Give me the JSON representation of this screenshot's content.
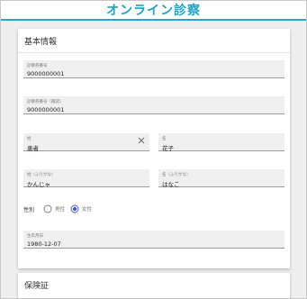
{
  "app": {
    "title": "オンライン診察"
  },
  "basic_info": {
    "title": "基本情報",
    "fields": [
      {
        "label": "診察券番号",
        "value": "9000000001"
      },
      {
        "label": "診察券番号（確認）",
        "value": "9000000001"
      },
      {
        "label": "姓",
        "value": "患者"
      },
      {
        "label": "名",
        "value": "花子"
      },
      {
        "label": "姓（ふりがな）",
        "value": "かんじゃ"
      },
      {
        "label": "名（ふりがな）",
        "value": "はなこ"
      },
      {
        "label": "生年月日",
        "value": "1980-12-07"
      }
    ],
    "gender": {
      "label": "性別",
      "options": [
        "男性",
        "女性"
      ],
      "selected": "女性"
    }
  },
  "insurance": {
    "title": "保険証"
  },
  "colors": {
    "accent": "#1aa3c9",
    "radio": "#3b5bdb"
  },
  "icons": {
    "clear": "close-icon"
  }
}
